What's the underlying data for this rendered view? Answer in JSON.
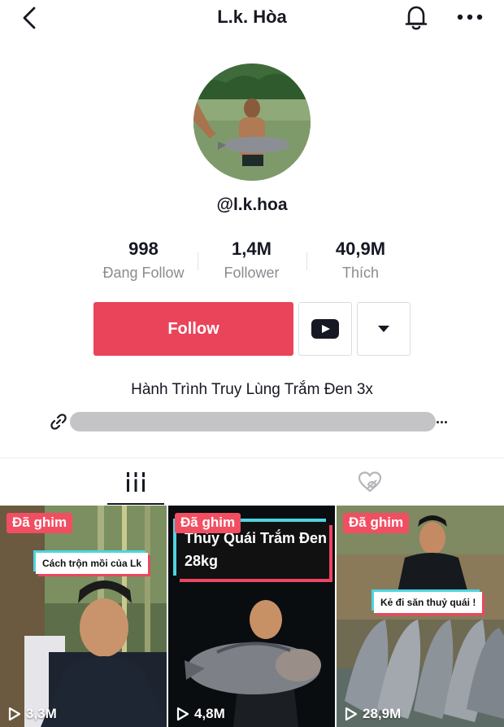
{
  "header": {
    "title": "L.k. Hòa"
  },
  "profile": {
    "username": "@l.k.hoa",
    "bio": "Hành Trình Truy Lùng Trắm Đen 3x",
    "link_more": "..."
  },
  "stats": [
    {
      "value": "998",
      "label": "Đang Follow"
    },
    {
      "value": "1,4M",
      "label": "Follower"
    },
    {
      "value": "40,9M",
      "label": "Thích"
    }
  ],
  "actions": {
    "follow_label": "Follow"
  },
  "videos": [
    {
      "pin_label": "Đã ghim",
      "caption": "Cách trộn mồi của Lk",
      "views": "3,3M"
    },
    {
      "pin_label": "Đã ghim",
      "caption_line1": "Thủy Quái Trắm Đen",
      "caption_line2": "28kg",
      "views": "4,8M"
    },
    {
      "pin_label": "Đã ghim",
      "caption": "Kẻ đi săn thuỷ quái !",
      "views": "28,9M"
    }
  ],
  "colors": {
    "accent": "#ea445a",
    "pin": "#f24e62",
    "text_primary": "#161823",
    "text_secondary": "#8a8b91"
  },
  "icons": {
    "back": "chevron-left-icon",
    "bell": "bell-icon",
    "more": "more-horizontal-icon",
    "youtube": "youtube-icon",
    "dropdown": "caret-down-icon",
    "link": "link-icon",
    "videos_tab": "grid-bars-icon",
    "liked_tab": "heart-hidden-icon",
    "play": "play-icon"
  }
}
